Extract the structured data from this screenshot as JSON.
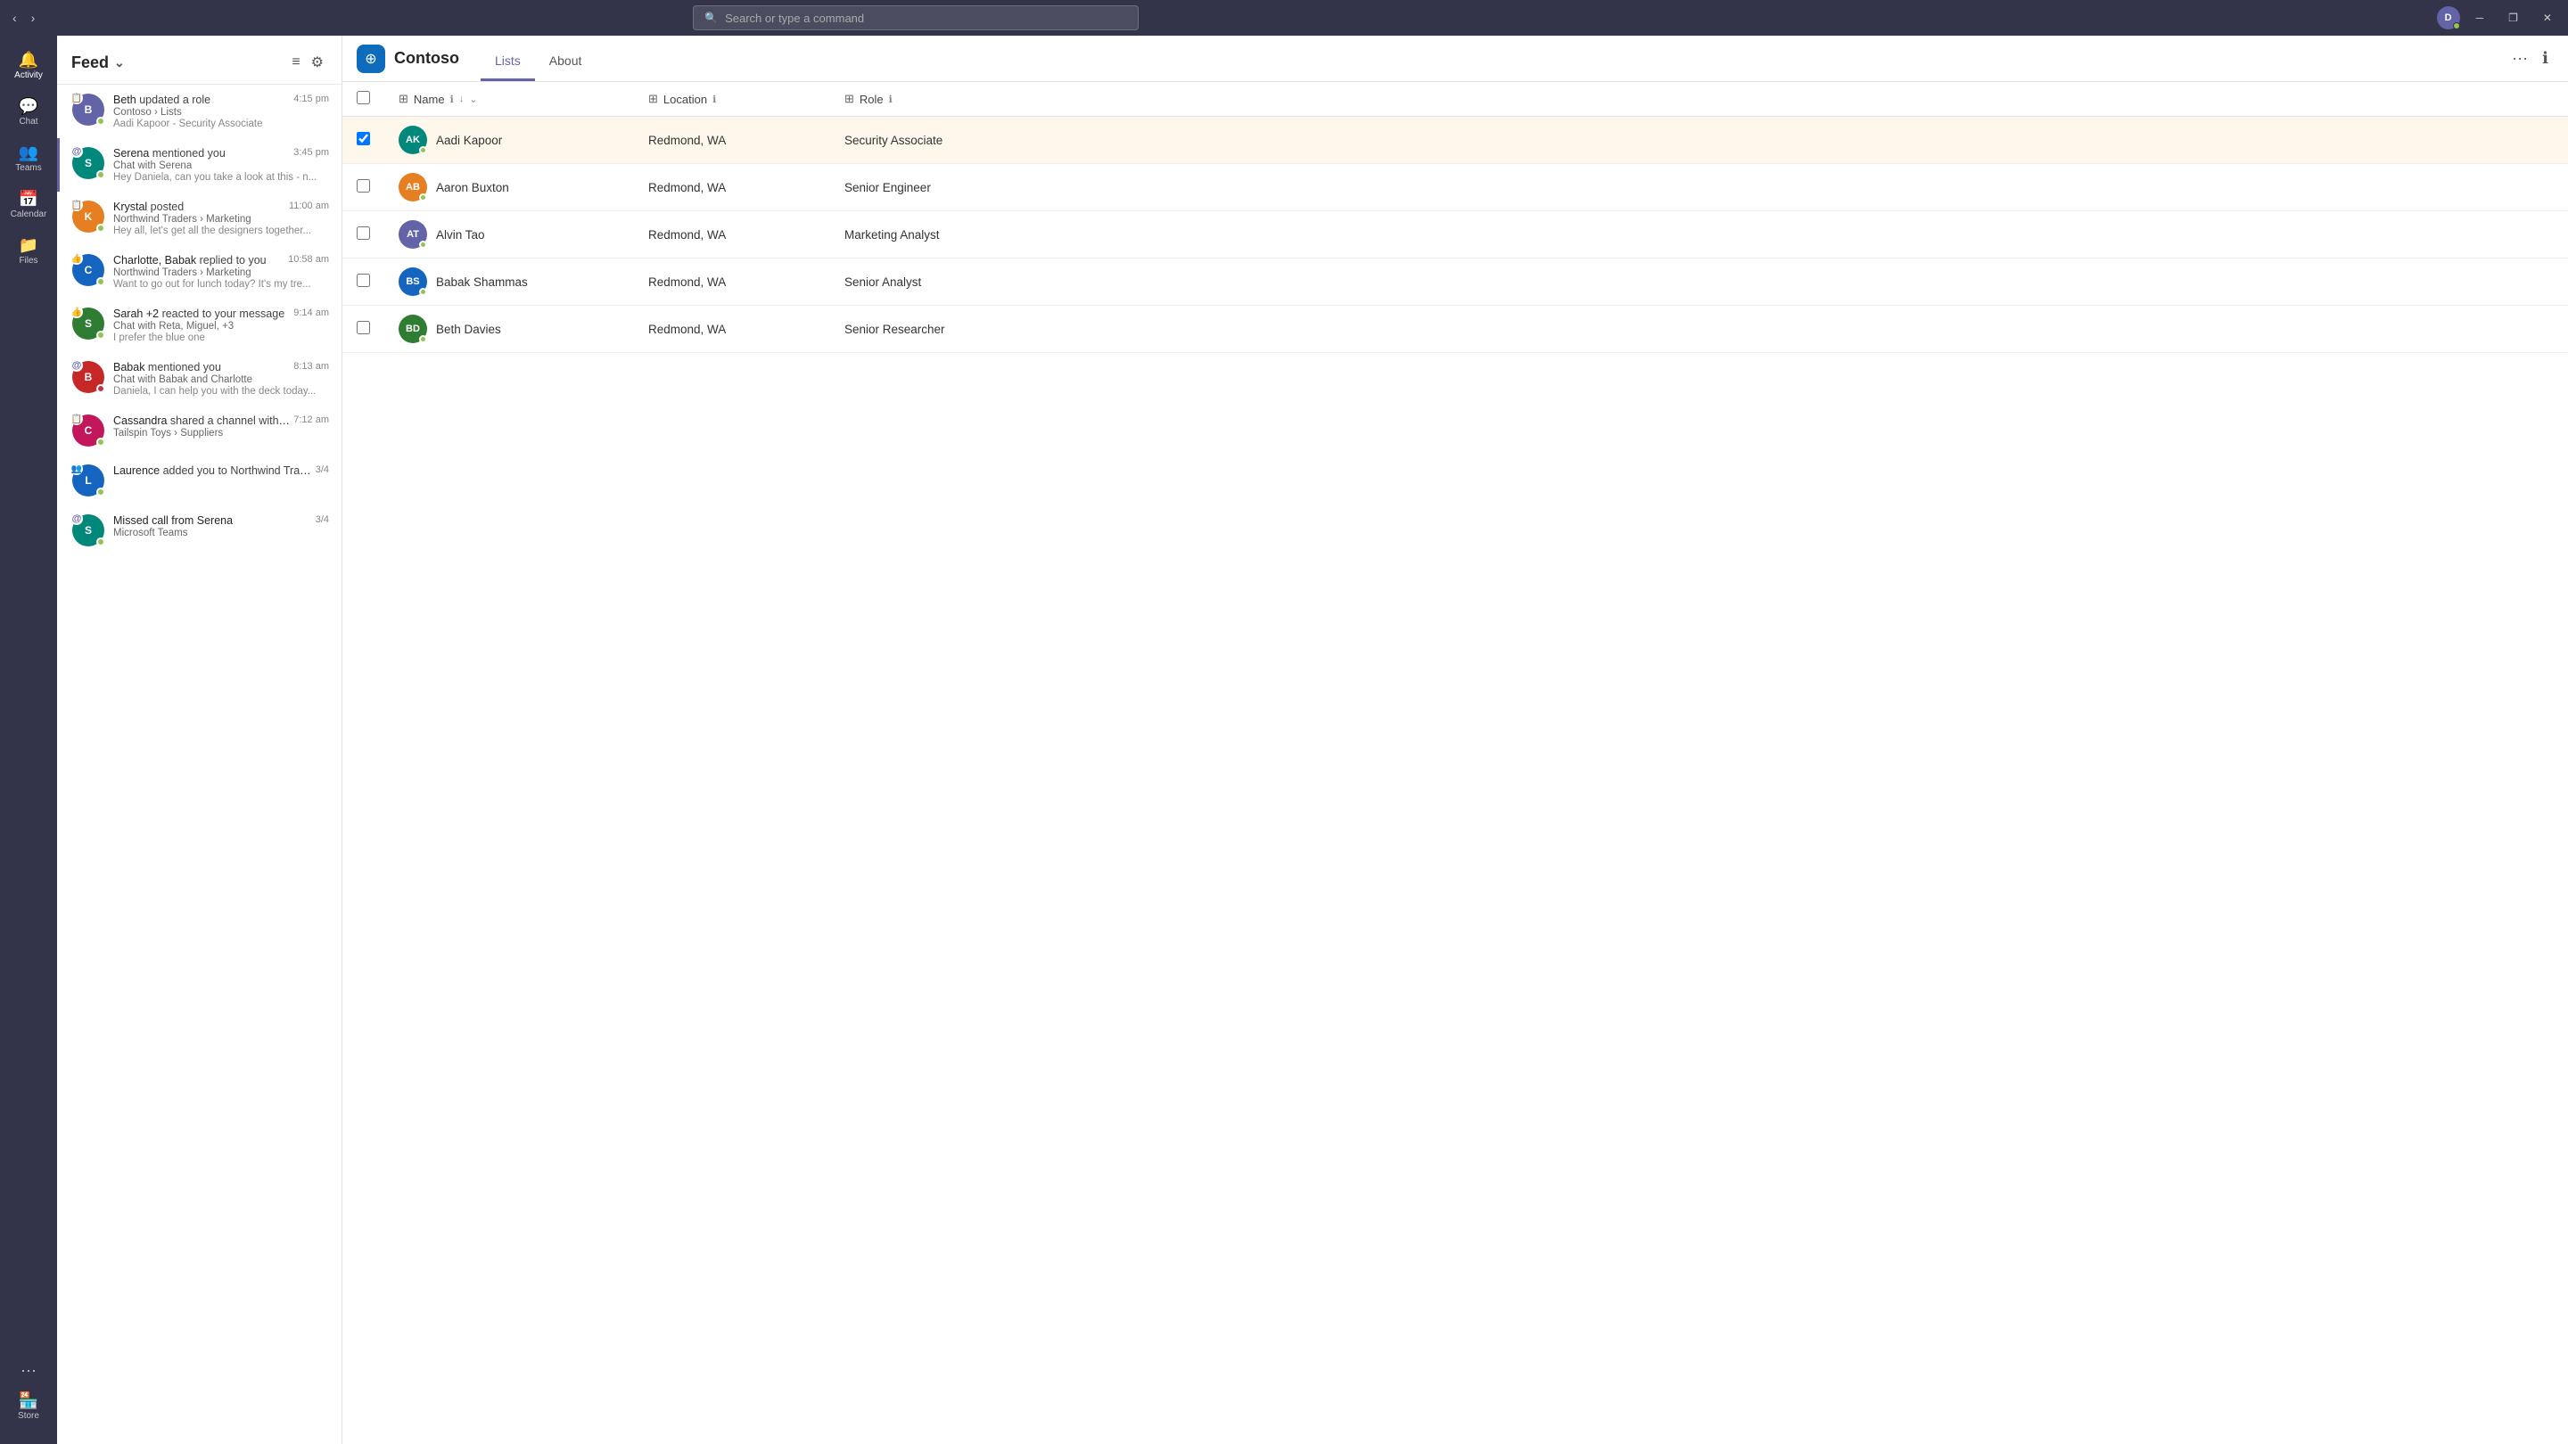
{
  "titlebar": {
    "nav_back": "‹",
    "nav_forward": "›",
    "search_placeholder": "Search or type a command",
    "win_minimize": "─",
    "win_restore": "❐",
    "win_close": "✕",
    "user_initials": "D"
  },
  "sidebar": {
    "items": [
      {
        "id": "activity",
        "label": "Activity",
        "icon": "🔔",
        "active": true
      },
      {
        "id": "chat",
        "label": "Chat",
        "icon": "💬",
        "active": false
      },
      {
        "id": "teams",
        "label": "Teams",
        "icon": "👥",
        "active": false
      },
      {
        "id": "calendar",
        "label": "Calendar",
        "icon": "📅",
        "active": false
      },
      {
        "id": "files",
        "label": "Files",
        "icon": "📁",
        "active": false
      }
    ],
    "more_label": "•••"
  },
  "feed": {
    "title": "Feed",
    "items": [
      {
        "id": 1,
        "name": "Beth",
        "action": "updated a role",
        "time": "4:15 pm",
        "sub": "Contoso › Lists",
        "preview": "Aadi Kapoor - Security Associate",
        "initials": "B",
        "color": "av-purple",
        "status": "online",
        "type_icon": "📋",
        "unread": false
      },
      {
        "id": 2,
        "name": "Serena",
        "action": "mentioned you",
        "time": "3:45 pm",
        "sub": "Chat with Serena",
        "preview": "Hey Daniela, can you take a look at this - n...",
        "initials": "S",
        "color": "av-teal",
        "status": "online",
        "type_icon": "@",
        "unread": true
      },
      {
        "id": 3,
        "name": "Krystal",
        "action": "posted",
        "time": "11:00 am",
        "sub": "Northwind Traders › Marketing",
        "preview": "Hey all, let's get all the designers together...",
        "initials": "K",
        "color": "av-orange",
        "status": "online",
        "type_icon": "📋",
        "unread": false
      },
      {
        "id": 4,
        "name": "Charlotte, Babak",
        "action": "replied to you",
        "time": "10:58 am",
        "sub": "Northwind Traders › Marketing",
        "preview": "Want to go out for lunch today? It's my tre...",
        "initials": "C",
        "color": "av-blue",
        "status": "online",
        "type_icon": "👍",
        "unread": false
      },
      {
        "id": 5,
        "name": "Sarah +2",
        "action": "reacted to your message",
        "time": "9:14 am",
        "sub": "Chat with Reta, Miguel, +3",
        "preview": "I prefer the blue one",
        "initials": "S",
        "color": "av-green",
        "status": "online",
        "type_icon": "👍",
        "unread": false
      },
      {
        "id": 6,
        "name": "Babak",
        "action": "mentioned you",
        "time": "8:13 am",
        "sub": "Chat with Babak and Charlotte",
        "preview": "Daniela, I can help you with the deck today...",
        "initials": "B",
        "color": "av-red",
        "status": "dnd",
        "type_icon": "@",
        "unread": false
      },
      {
        "id": 7,
        "name": "Cassandra",
        "action": "shared a channel with you",
        "time": "7:12 am",
        "sub": "Tailspin Toys › Suppliers",
        "preview": "",
        "initials": "C",
        "color": "av-pink",
        "status": "online",
        "type_icon": "📋",
        "unread": false
      },
      {
        "id": 8,
        "name": "Laurence",
        "action": "added you to Northwind Traders",
        "time": "3/4",
        "sub": "",
        "preview": "",
        "initials": "L",
        "color": "av-blue",
        "status": "online",
        "type_icon": "👥",
        "unread": false
      },
      {
        "id": 9,
        "name": "Missed call from Serena",
        "action": "",
        "time": "3/4",
        "sub": "Microsoft Teams",
        "preview": "",
        "initials": "S",
        "color": "av-teal",
        "status": "online",
        "type_icon": "@",
        "unread": false
      }
    ]
  },
  "app": {
    "icon": "≡",
    "title": "Contoso",
    "tabs": [
      {
        "id": "lists",
        "label": "Lists",
        "active": true
      },
      {
        "id": "about",
        "label": "About",
        "active": false
      }
    ]
  },
  "table": {
    "columns": [
      {
        "id": "name",
        "label": "Name",
        "icon": "⊞"
      },
      {
        "id": "location",
        "label": "Location",
        "icon": "⊞"
      },
      {
        "id": "role",
        "label": "Role",
        "icon": "⊞"
      }
    ],
    "rows": [
      {
        "id": 1,
        "name": "Aadi Kapoor",
        "location": "Redmond, WA",
        "role": "Security Associate",
        "initials": "AK",
        "color": "av-teal",
        "selected": true
      },
      {
        "id": 2,
        "name": "Aaron Buxton",
        "location": "Redmond, WA",
        "role": "Senior Engineer",
        "initials": "AB",
        "color": "av-orange",
        "selected": false
      },
      {
        "id": 3,
        "name": "Alvin Tao",
        "location": "Redmond, WA",
        "role": "Marketing Analyst",
        "initials": "AT",
        "color": "av-purple",
        "selected": false
      },
      {
        "id": 4,
        "name": "Babak Shammas",
        "location": "Redmond, WA",
        "role": "Senior Analyst",
        "initials": "BS",
        "color": "av-blue",
        "selected": false
      },
      {
        "id": 5,
        "name": "Beth Davies",
        "location": "Redmond, WA",
        "role": "Senior Researcher",
        "initials": "BD",
        "color": "av-green",
        "selected": false
      }
    ]
  }
}
